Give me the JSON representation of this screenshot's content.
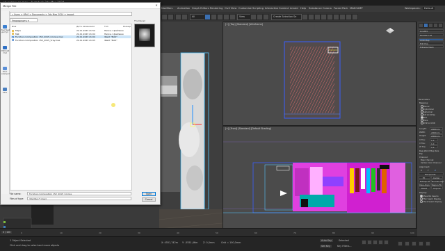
{
  "window": {
    "title": "ий интерьер.max - Autodesk 3ds Max 2024"
  },
  "menubar": {
    "items": [
      "Modifiers",
      "Animation",
      "Graph Editors",
      "Rendering",
      "Civil View",
      "Customize",
      "Scripting",
      "Interactive",
      "Content",
      "Arnold",
      "Help",
      "Substance",
      "Corona",
      "Forest Pack",
      "MADCAMP"
    ],
    "workspace_label": "Workspaces:",
    "workspace_value": "Default"
  },
  "toolbar": {
    "selection_filter": "All",
    "view_combo": "View",
    "named_sel": "Create Selection Se"
  },
  "dialog": {
    "title": "Merge File",
    "path": "« Users > 6Pc0 > Documents > 3ds Max 2024 > import",
    "organize_label": "Упорядочить ▾",
    "places": [
      "Быстрый доступ",
      "Рабочий стол",
      "Этот компьютер",
      "Сеть"
    ],
    "columns": {
      "name": "Имя",
      "date": "Дата изменения",
      "type": "Тип",
      "size": "Размер"
    },
    "files": [
      {
        "name": "Maps",
        "date": "22.11.2023 21:52",
        "type": "Папка с файлами",
        "size": "",
        "kind": "folder",
        "selected": false
      },
      {
        "name": "Mat",
        "date": "22.11.2023 21:04",
        "type": "Папка с файлами",
        "size": "",
        "kind": "folder",
        "selected": false
      },
      {
        "name": "Furniture Composition 152_2015_Corona.max",
        "date": "22.11.2023 21:04",
        "type": "Файл \"MAX\"",
        "size": "",
        "kind": "file",
        "selected": true
      },
      {
        "name": "Furniture Composition 152_2015_Vray.max",
        "date": "22.11.2023 21:03",
        "type": "Файл \"MAX\"",
        "size": "",
        "kind": "file",
        "selected": false
      }
    ],
    "thumbnail_label": "Thumbnail",
    "filename_label": "File name:",
    "filename_value": "Furniture Composition 152_2015_Corona",
    "filetype_label": "Files of type:",
    "filetype_value": "3ds Max (*.max)",
    "open_button": "Open",
    "cancel_button": "Cancel",
    "history_label": "History:"
  },
  "viewports": {
    "top_label": "[+] [Top] [Standard] [Wireframe]",
    "front_label": "[+] [Front] [Standard] [Default Shading]"
  },
  "command_panel": {
    "object_name": "Line001",
    "modifier_list": "Modifier List",
    "stack_items": [
      "UVW Map",
      "Edit Poly",
      "Editable Mesh"
    ],
    "rollout": "Parameters",
    "mapping_label": "Mapping:",
    "mapping_options": [
      "Planar",
      "Cylindrical",
      "Spherical",
      "Shrink Wrap",
      "Box",
      "Face",
      "XYZ to UVW"
    ],
    "mapping_selected": "Box",
    "fields": [
      {
        "label": "Length:",
        "value": "2000mm"
      },
      {
        "label": "Width:",
        "value": "2000mm"
      },
      {
        "label": "Height:",
        "value": "2000mm"
      },
      {
        "label": "U Tile:",
        "value": "1,0"
      },
      {
        "label": "V Tile:",
        "value": "1,0"
      },
      {
        "label": "W Tile:",
        "value": "1,0"
      }
    ],
    "checkbox_labels": [
      "Real-World Map Size",
      "Flip",
      "Channel:",
      "Map Channel:",
      "Vertex Color Channel"
    ],
    "alignment_label": "Alignment:",
    "align_axes": [
      "X",
      "Y",
      "Z"
    ],
    "align_buttons": [
      "Manipulate",
      "Fit",
      "Center",
      "Bitmap Fit",
      "Normal Align",
      "View Align",
      "Region Fit",
      "Reset",
      "Acquire"
    ],
    "display_label": "Display:",
    "display_options": [
      "Show No Seams",
      "Thin Seam Display",
      "Thick Seam Display"
    ]
  },
  "status": {
    "selected": "1 Object Selected",
    "prompt": "Click and drag to select and move objects",
    "x": "X: 4551,742m",
    "y": "Y: -5551,46m",
    "z": "Z: 0,0mm",
    "grid": "Grid = 100,0mm",
    "auto_key": "Auto Key",
    "selected_btn": "Selected",
    "set_key": "Set Key",
    "key_filters": "Key Filters..."
  },
  "timeline": {
    "frame": "0 / 100",
    "ticks": [
      "0",
      "10",
      "20",
      "30",
      "40",
      "50",
      "60",
      "70",
      "80",
      "90",
      "100"
    ]
  },
  "colors": {
    "accent": "#3b6fb0",
    "selection": "#cce4f7",
    "magenta": "#e040e0",
    "blue_wire": "#3a5fff",
    "cyan_wire": "#55c8ff"
  }
}
